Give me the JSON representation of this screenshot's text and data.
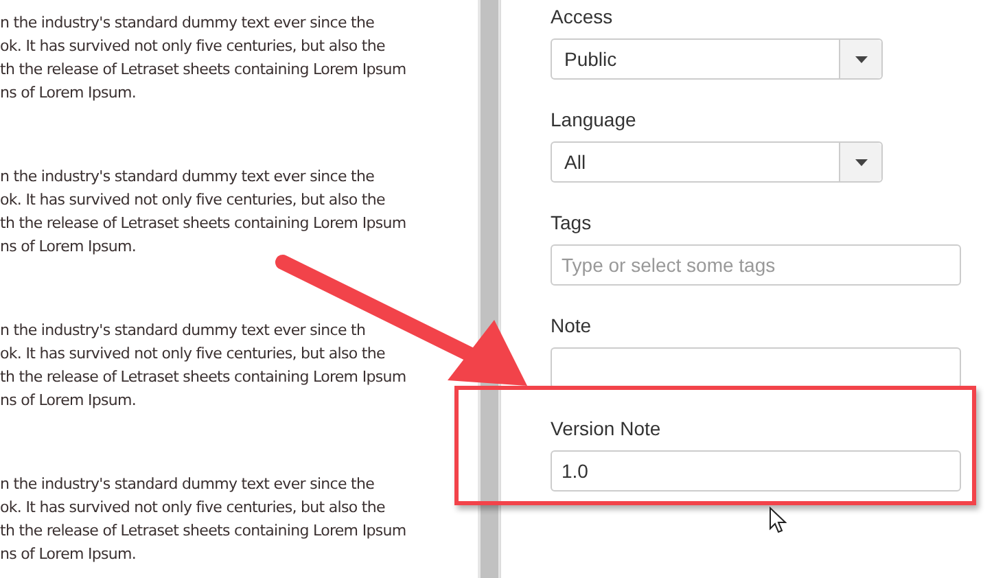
{
  "article": {
    "paragraphs": [
      {
        "lines": [
          "n the industry's standard dummy text ever since the",
          "ok. It has survived not only five centuries, but also the",
          "th the release of Letraset sheets containing Lorem Ipsum",
          "ns of Lorem Ipsum."
        ]
      },
      {
        "lines": [
          "n the industry's standard dummy text ever since the",
          "ok. It has survived not only five centuries, but also the",
          "th the release of Letraset sheets containing Lorem Ipsum",
          "ns of Lorem Ipsum."
        ]
      },
      {
        "lines": [
          "n the industry's standard dummy text ever since th",
          "ok. It has survived not only five centuries, but also the",
          "th the release of Letraset sheets containing Lorem Ipsum",
          "ns of Lorem Ipsum."
        ]
      },
      {
        "lines": [
          "n the industry's standard dummy text ever since the",
          "ok. It has survived not only five centuries, but also the",
          "th the release of Letraset sheets containing Lorem Ipsum",
          "ns of Lorem Ipsum."
        ]
      }
    ]
  },
  "form": {
    "fields": [
      {
        "kind": "select",
        "label": "Access",
        "value": "Public"
      },
      {
        "kind": "select",
        "label": "Language",
        "value": "All"
      },
      {
        "kind": "input",
        "label": "Tags",
        "placeholder": "Type or select some tags"
      },
      {
        "kind": "input",
        "label": "Note"
      },
      {
        "kind": "input",
        "label": "Version Note",
        "value": "1.0"
      }
    ]
  }
}
